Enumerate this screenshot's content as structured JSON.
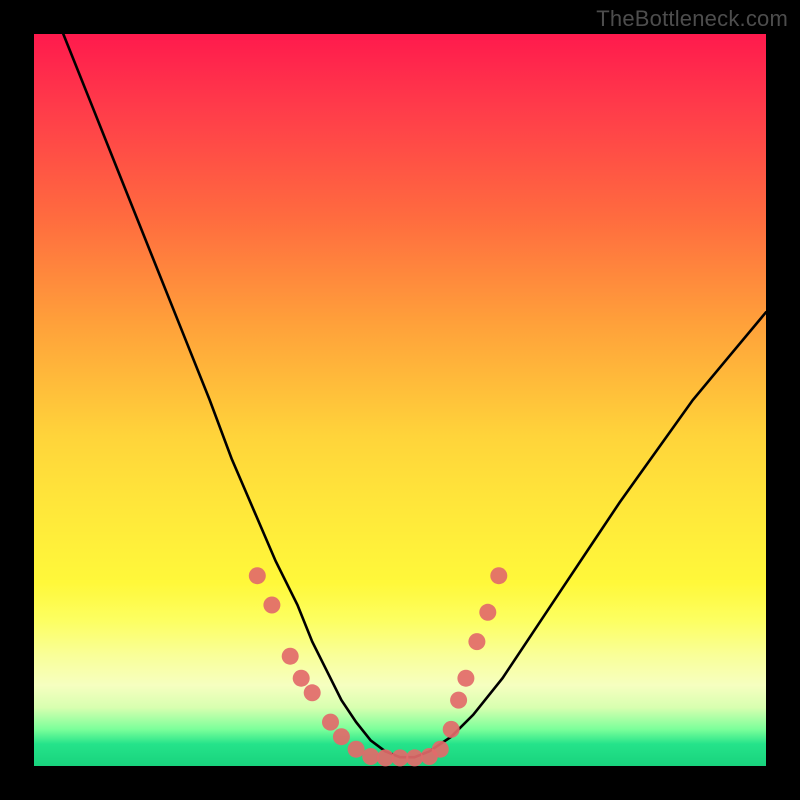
{
  "watermark": "TheBottleneck.com",
  "chart_data": {
    "type": "line",
    "title": "",
    "xlabel": "",
    "ylabel": "",
    "xlim": [
      0,
      100
    ],
    "ylim": [
      0,
      100
    ],
    "series": [
      {
        "name": "bottleneck-curve",
        "x": [
          4,
          8,
          12,
          16,
          20,
          24,
          27,
          30,
          33,
          36,
          38,
          40,
          42,
          44,
          46,
          48,
          50,
          52,
          54,
          57,
          60,
          64,
          68,
          72,
          76,
          80,
          85,
          90,
          95,
          100
        ],
        "y": [
          100,
          90,
          80,
          70,
          60,
          50,
          42,
          35,
          28,
          22,
          17,
          13,
          9,
          6,
          3.5,
          2,
          1.2,
          1.2,
          2,
          4,
          7,
          12,
          18,
          24,
          30,
          36,
          43,
          50,
          56,
          62
        ]
      }
    ],
    "scatter": {
      "name": "sample-points",
      "color": "#e26a6a",
      "points": [
        {
          "x": 30.5,
          "y": 26
        },
        {
          "x": 32.5,
          "y": 22
        },
        {
          "x": 35,
          "y": 15
        },
        {
          "x": 36.5,
          "y": 12
        },
        {
          "x": 38,
          "y": 10
        },
        {
          "x": 40.5,
          "y": 6
        },
        {
          "x": 42,
          "y": 4
        },
        {
          "x": 44,
          "y": 2.3
        },
        {
          "x": 46,
          "y": 1.3
        },
        {
          "x": 48,
          "y": 1.1
        },
        {
          "x": 50,
          "y": 1.1
        },
        {
          "x": 52,
          "y": 1.1
        },
        {
          "x": 54,
          "y": 1.3
        },
        {
          "x": 55.5,
          "y": 2.3
        },
        {
          "x": 57,
          "y": 5
        },
        {
          "x": 58,
          "y": 9
        },
        {
          "x": 59,
          "y": 12
        },
        {
          "x": 60.5,
          "y": 17
        },
        {
          "x": 62,
          "y": 21
        },
        {
          "x": 63.5,
          "y": 26
        }
      ]
    }
  }
}
